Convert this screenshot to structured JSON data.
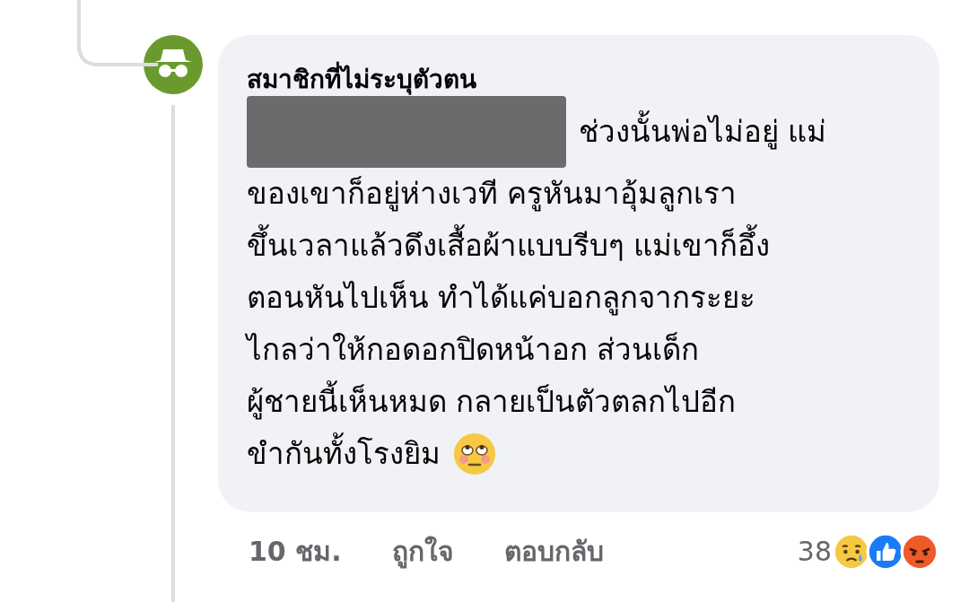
{
  "comment": {
    "author": "สมาชิกที่ไม่ระบุตัวตน",
    "redacted": true,
    "lines": [
      "ช่วงนั้นพ่อไม่อยู่ แม่",
      "ของเขาก็อยู่ห่างเวที ครูหันมาอุ้มลูกเรา",
      "ขึ้นเวลาแล้วดึงเสื้อผ้าแบบรีบๆ แม่เขาก็อึ้ง",
      "ตอนหันไปเห็น ทำได้แค่บอกลูกจากระยะ",
      "ไกลว่าให้กอดอกปิดหน้าอก ส่วนเด็ก",
      "ผู้ชายนี้เห็นหมด กลายเป็นตัวตลกไปอีก",
      "ขำกันทั้งโรงยิม"
    ],
    "time": "10 ชม.",
    "like": "ถูกใจ",
    "reply": "ตอบกลับ",
    "reaction_count": "38",
    "reactions": [
      {
        "kind": "sad"
      },
      {
        "kind": "like"
      },
      {
        "kind": "angry"
      }
    ]
  }
}
